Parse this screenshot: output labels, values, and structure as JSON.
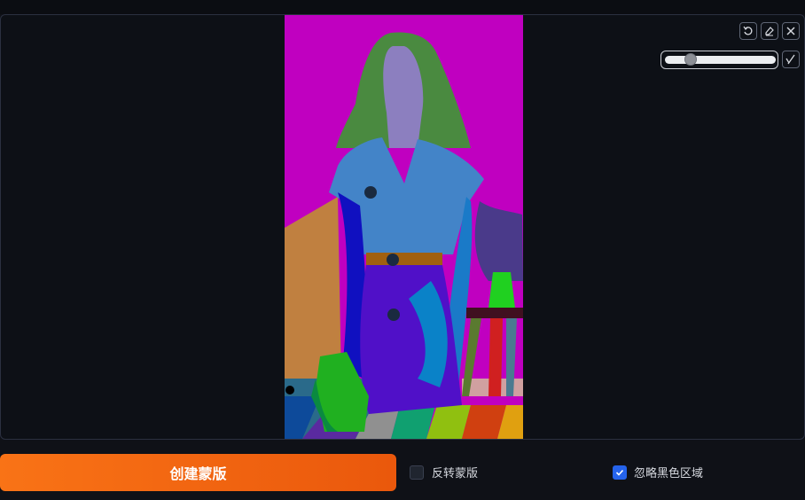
{
  "image": {
    "description_icon": "segmentation-mask-image"
  },
  "toolbar": {
    "icons": [
      "reset-icon",
      "eraser-icon",
      "close-icon",
      "brush-icon"
    ]
  },
  "brush_size": {
    "value": 0.2
  },
  "actions": {
    "create_mask_label": "创建蒙版"
  },
  "options": {
    "invert_mask_label": "反转蒙版",
    "invert_mask_checked": false,
    "ignore_black_label": "忽略黑色区域",
    "ignore_black_checked": true
  },
  "colors": {
    "accent": "#f97316",
    "checkbox_on": "#2563eb"
  }
}
